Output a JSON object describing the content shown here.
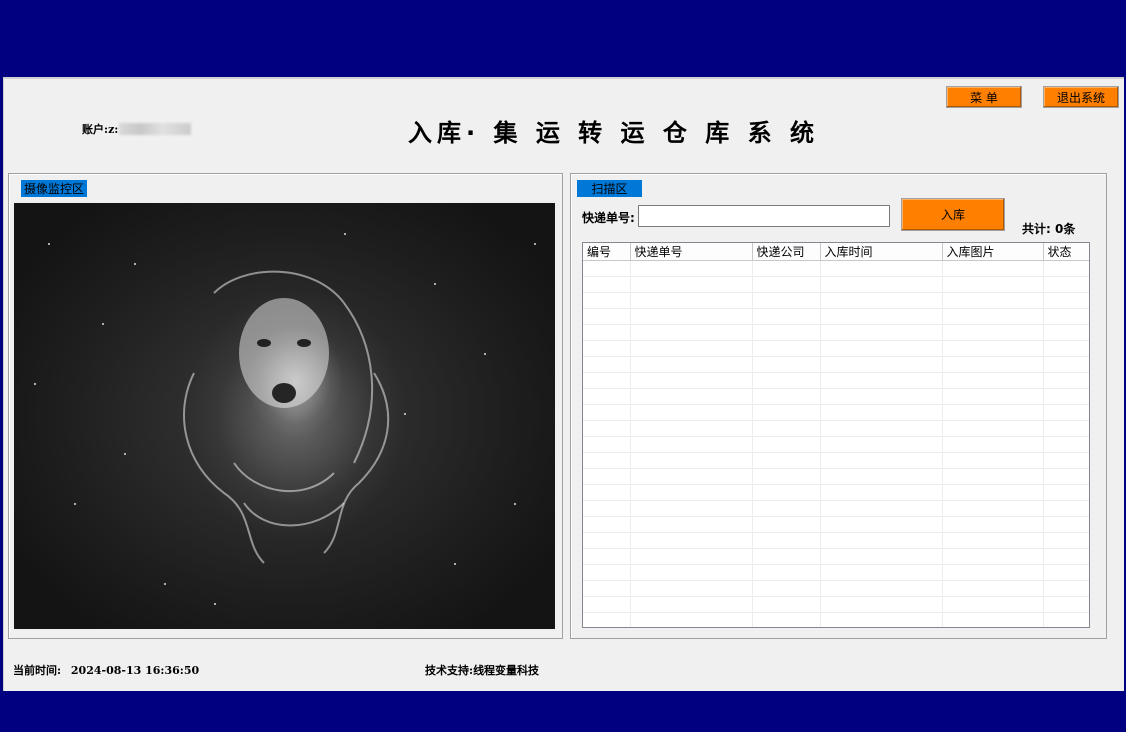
{
  "header": {
    "menu_button": "菜 单",
    "exit_button": "退出系统",
    "account_label": "账户:",
    "account_value": "z:",
    "title": "入库· 集 运 转 运 仓 库 系 统"
  },
  "camera_panel": {
    "tag": "摄像监控区",
    "feed_image": "wolf-in-smoke-image"
  },
  "scan_panel": {
    "tag": "扫描区",
    "tracking_label": "快递单号:",
    "tracking_value": "",
    "tracking_placeholder": "",
    "inbound_button": "入库",
    "total_label": "共计:",
    "total_value": "0条"
  },
  "table": {
    "columns": [
      "编号",
      "快递单号",
      "快递公司",
      "入库时间",
      "入库图片",
      "状态"
    ],
    "rows": []
  },
  "footer": {
    "time_label": "当前时间:",
    "time_value": "2024-08-13 16:36:50",
    "support_label": "技术支持:",
    "support_value": "线程变量科技"
  },
  "colors": {
    "desktop_bg": "#000080",
    "window_bg": "#f0f0f0",
    "accent_orange": "#ff8000",
    "tag_blue": "#0078d7"
  }
}
